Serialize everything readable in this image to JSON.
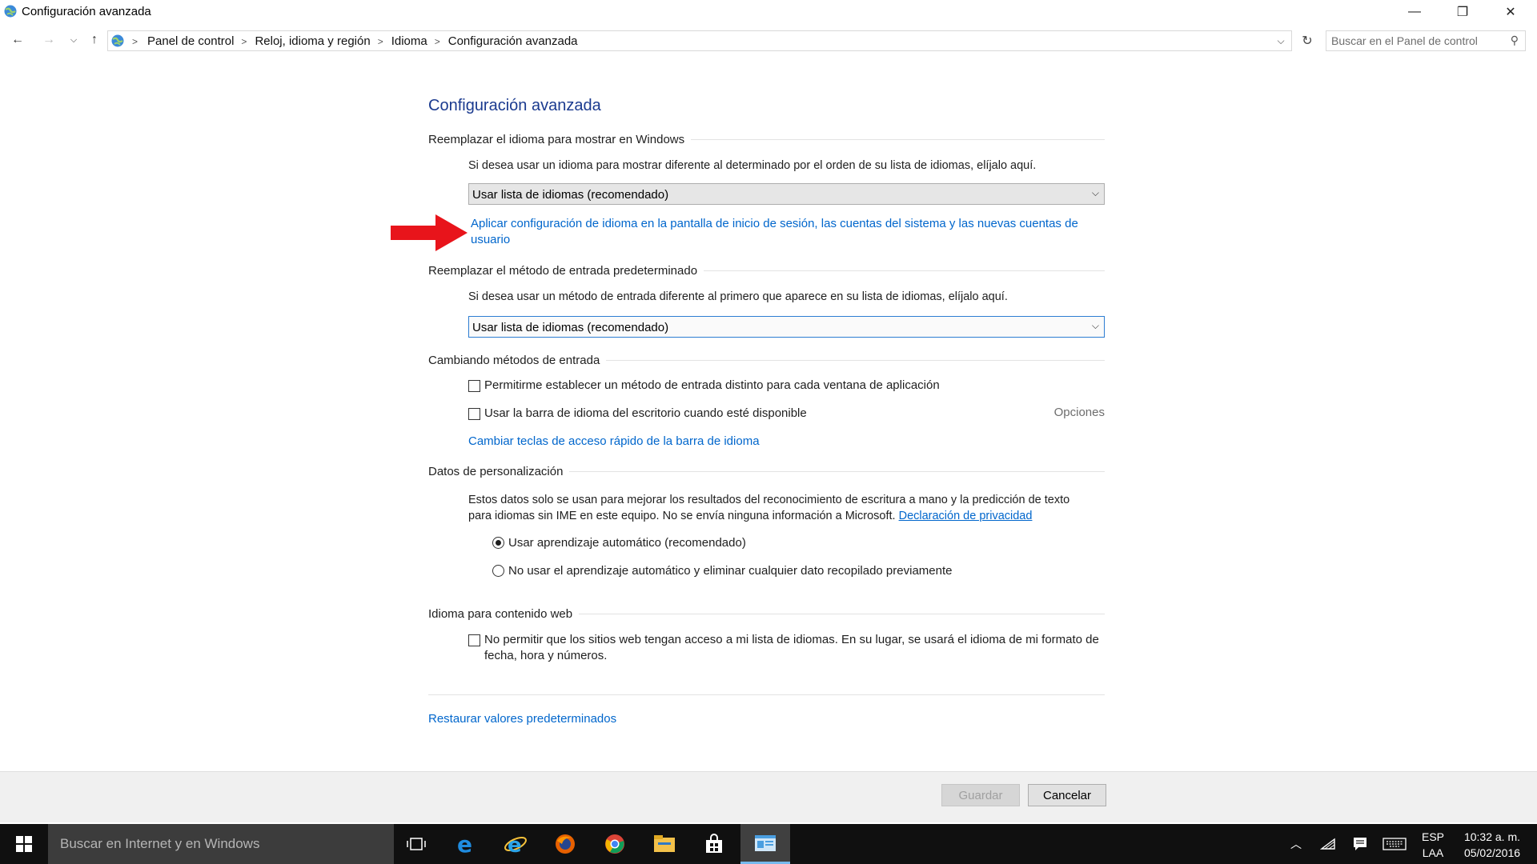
{
  "window": {
    "title": "Configuración avanzada",
    "controls": {
      "minimize": "—",
      "maximize": "❐",
      "close": "✕"
    }
  },
  "nav": {
    "breadcrumbs": [
      "Panel de control",
      "Reloj, idioma y región",
      "Idioma",
      "Configuración avanzada"
    ],
    "search_placeholder": "Buscar en el Panel de control"
  },
  "content": {
    "page_title": "Configuración avanzada",
    "display_language": {
      "heading": "Reemplazar el idioma para mostrar en Windows",
      "description": "Si desea usar un idioma para mostrar diferente al determinado por el orden de su lista de idiomas, elíjalo aquí.",
      "dropdown_value": "Usar lista de idiomas (recomendado)",
      "apply_link": "Aplicar configuración de idioma en la pantalla de inicio de sesión, las cuentas del sistema y las nuevas cuentas de usuario"
    },
    "input_method": {
      "heading": "Reemplazar el método de entrada predeterminado",
      "description": "Si desea usar un método de entrada diferente al primero que aparece en su lista de idiomas, elíjalo aquí.",
      "dropdown_value": "Usar lista de idiomas (recomendado)"
    },
    "switching": {
      "heading": "Cambiando métodos de entrada",
      "checkbox_per_app": "Permitirme establecer un método de entrada distinto para cada ventana de aplicación",
      "checkbox_language_bar": "Usar la barra de idioma del escritorio cuando esté disponible",
      "options_link": "Opciones",
      "hotkeys_link": "Cambiar teclas de acceso rápido de la barra de idioma"
    },
    "personalization": {
      "heading": "Datos de personalización",
      "description_line1": "Estos datos solo se usan para mejorar los resultados del reconocimiento de escritura a mano y la predicción de texto",
      "description_line2": "para idiomas sin IME en este equipo. No se envía ninguna información a Microsoft.",
      "privacy_link": "Declaración de privacidad",
      "radio_auto": "Usar aprendizaje automático (recomendado)",
      "radio_no_auto": "No usar el aprendizaje automático y eliminar cualquier dato recopilado previamente",
      "selected": "radio_auto"
    },
    "web_content": {
      "heading": "Idioma para contenido web",
      "checkbox_label": "No permitir que los sitios web tengan acceso a mi lista de idiomas. En su lugar, se usará el idioma de mi formato de fecha, hora y números."
    },
    "restore_link": "Restaurar valores predeterminados"
  },
  "footer": {
    "save_label": "Guardar",
    "cancel_label": "Cancelar"
  },
  "taskbar": {
    "search_placeholder": "Buscar en Internet y en Windows",
    "language": "ESP",
    "layout": "LAA",
    "time": "10:32 a. m.",
    "date": "05/02/2016"
  },
  "colors": {
    "link": "#0066cc",
    "title": "#1a3a8f",
    "annotation_arrow": "#e8141b",
    "taskbar": "#101010"
  }
}
